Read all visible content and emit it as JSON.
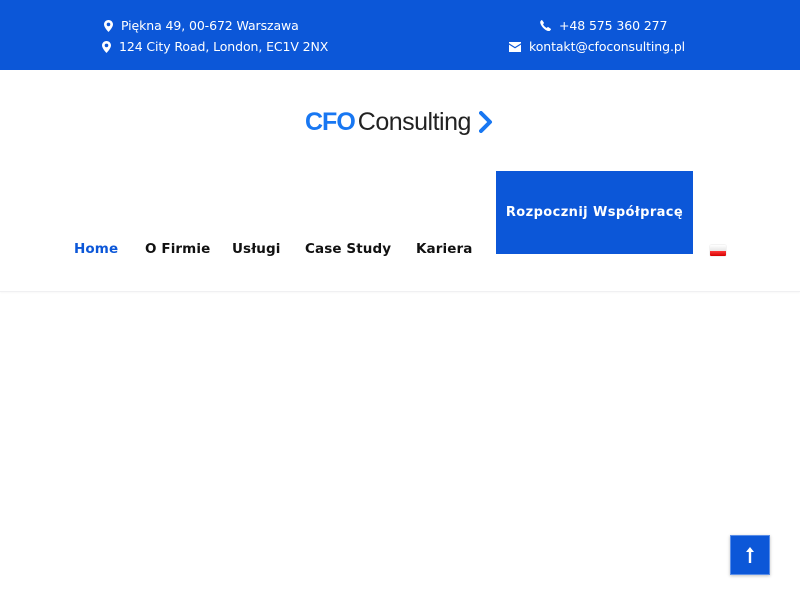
{
  "topbar": {
    "address_warsaw": "Piękna 49, 00-672 Warszawa",
    "address_london": "124 City Road, London, EC1V 2NX",
    "phone": "+48 575 360 277",
    "email": "kontakt@cfoconsulting.pl",
    "icons": [
      "map-marker-icon",
      "map-marker-icon",
      "phone-icon",
      "envelope-icon"
    ]
  },
  "logo": {
    "part1": "CFO",
    "part2": "Consulting"
  },
  "nav": {
    "items": [
      {
        "label": "Home",
        "active": true
      },
      {
        "label": "O Firmie",
        "active": false
      },
      {
        "label": "Usługi",
        "active": false
      },
      {
        "label": "Case Study",
        "active": false
      },
      {
        "label": "Kariera",
        "active": false
      }
    ],
    "cta_label": "Rozpocznij Współpracę",
    "language": "pl"
  },
  "colors": {
    "brand_blue": "#0c57d8",
    "logo_blue": "#1877f2",
    "text_dark": "#111111"
  }
}
